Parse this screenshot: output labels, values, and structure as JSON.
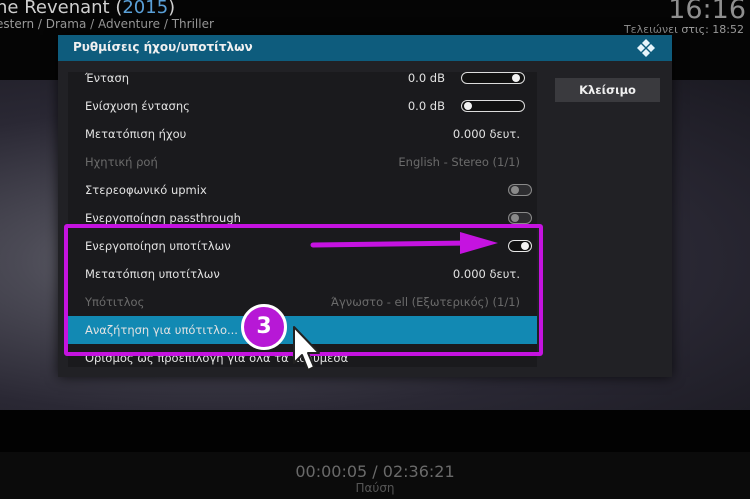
{
  "topbar": {
    "title": "he Revenant",
    "year": "2015",
    "year_open": " (",
    "year_close": ")",
    "genres": "estern / Drama / Adventure / Thriller",
    "clock": "16:16",
    "ends_at": "Τελειώνει στις: 18:52"
  },
  "dialog": {
    "title": "Ρυθμίσεις ήχου/υποτίτλων",
    "close_label": "Κλείσιμο",
    "rows": [
      {
        "label": "Ένταση",
        "value": "0.0 dB",
        "control": "slider",
        "level": 0.95
      },
      {
        "label": "Ενίσχυση έντασης",
        "value": "0.0 dB",
        "control": "slider",
        "level": 0.0
      },
      {
        "label": "Μετατόπιση ήχου",
        "value": "0.000 δευτ."
      },
      {
        "label": "Ηχητική ροή",
        "value": "English - Stereo (1/1)",
        "disabled": true
      },
      {
        "label": "Στερεοφωνικό upmix",
        "control": "toggle",
        "on": false
      },
      {
        "label": "Ενεργοποίηση passthrough",
        "control": "toggle",
        "on": false
      },
      {
        "label": "Ενεργοποίηση υποτίτλων",
        "control": "toggle",
        "on": true
      },
      {
        "label": "Μετατόπιση υποτίτλων",
        "value": "0.000 δευτ."
      },
      {
        "label": "Υπότιτλος",
        "value": "Άγνωστο - ell (Εξωτερικός) (1/1)",
        "disabled": true
      },
      {
        "label": "Αναζήτηση για υπότιτλο...",
        "selected": true
      },
      {
        "label": "Ορισμός ως προεπιλογή για όλα τα πολυμέσα"
      }
    ]
  },
  "annotation": {
    "step_number": "3",
    "color": "#c513e0"
  },
  "osd": {
    "time": "00:00:05 / 02:36:21",
    "status": "Παύση"
  },
  "colors": {
    "header_blue": "#0e5c7d",
    "selected_blue": "#1289b3",
    "year_blue": "#5aa0d8"
  }
}
